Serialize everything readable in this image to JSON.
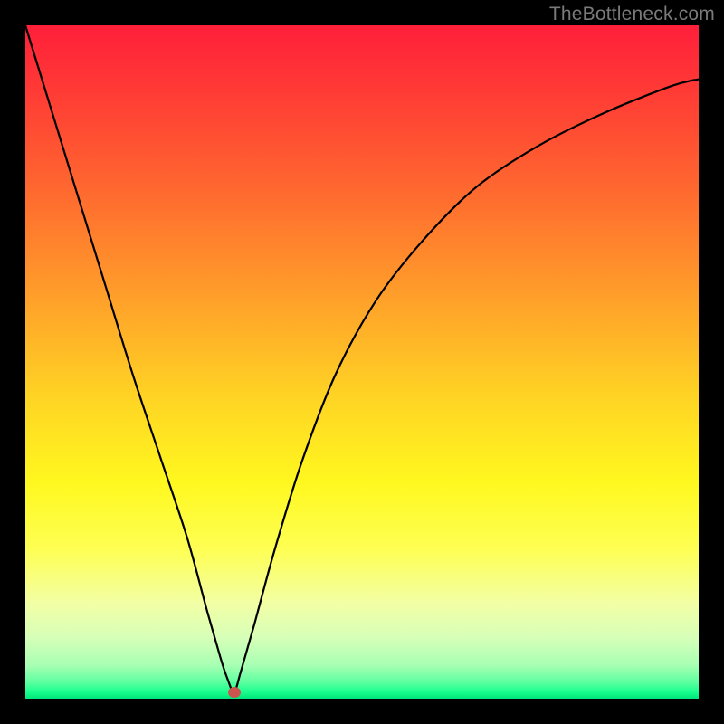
{
  "watermark": "TheBottleneck.com",
  "colors": {
    "frame": "#000000",
    "curve": "#000000",
    "marker": "#c9554e",
    "gradient_top": "#ff1f3a",
    "gradient_bottom": "#00e57a"
  },
  "chart_data": {
    "type": "line",
    "title": "",
    "xlabel": "",
    "ylabel": "",
    "xlim": [
      0,
      100
    ],
    "ylim": [
      0,
      100
    ],
    "grid": false,
    "legend": false,
    "annotations": [],
    "min_point": {
      "x": 31,
      "y": 1
    },
    "series": [
      {
        "name": "curve",
        "x": [
          0,
          4,
          8,
          12,
          16,
          20,
          24,
          27,
          29,
          30,
          31,
          32,
          34,
          37,
          41,
          46,
          52,
          59,
          67,
          76,
          86,
          96,
          100
        ],
        "values": [
          100,
          87,
          74,
          61,
          48,
          36,
          24,
          13,
          6,
          3,
          1,
          4,
          11,
          22,
          35,
          48,
          59,
          68,
          76,
          82,
          87,
          91,
          92
        ]
      }
    ]
  }
}
